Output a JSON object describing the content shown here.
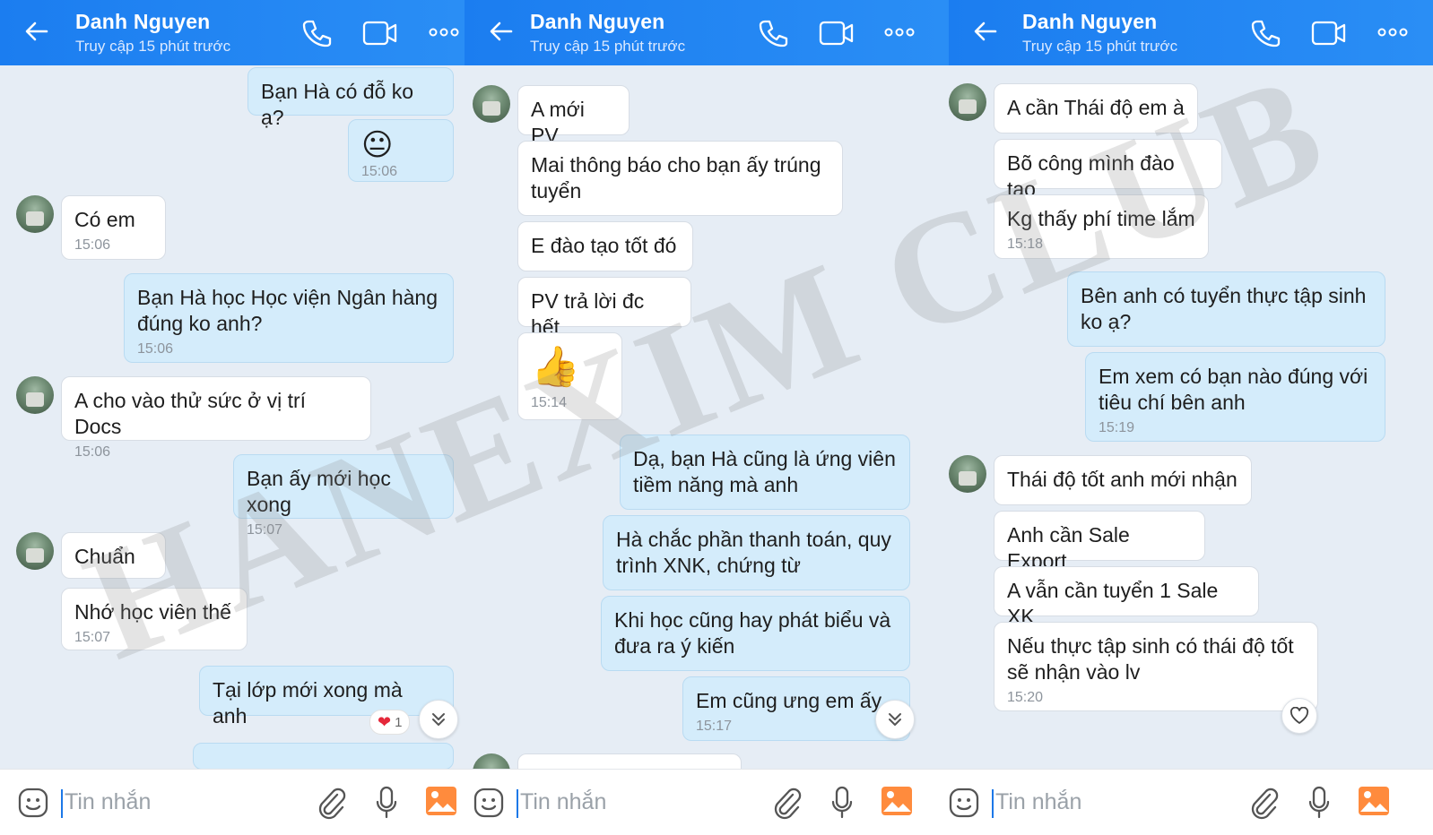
{
  "header": {
    "contact_name": "Danh Nguyen",
    "status": "Truy cập 15 phút trước"
  },
  "footer": {
    "placeholder": "Tin nhắn"
  },
  "watermark": "HANEXIM CLUB",
  "panel1": {
    "messages": [
      {
        "text": "Bạn Hà có đỗ ko ạ?"
      },
      {
        "emoji": "😐",
        "time": "15:06"
      },
      {
        "text": "Có em",
        "time": "15:06"
      },
      {
        "text": "Bạn Hà học Học viện Ngân hàng đúng ko anh?",
        "time": "15:06"
      },
      {
        "text": "A cho vào thử sức ở vị trí Docs",
        "time": "15:06"
      },
      {
        "text": "Bạn ấy mới học xong",
        "time": "15:07"
      },
      {
        "text": "Chuẩn"
      },
      {
        "text": "Nhớ học viên thế",
        "time": "15:07"
      },
      {
        "text": "Tại lớp mới xong mà anh",
        "reaction_count": "1"
      }
    ]
  },
  "panel2": {
    "messages": [
      {
        "text": "A mới PV"
      },
      {
        "text": "Mai thông báo cho bạn ấy trúng tuyển"
      },
      {
        "text": "E đào tạo tốt đó"
      },
      {
        "text": "PV trả lời đc hết"
      },
      {
        "emoji": "👍",
        "time": "15:14"
      },
      {
        "text": "Dạ, bạn Hà cũng là ứng viên tiềm năng mà anh"
      },
      {
        "text": "Hà chắc phần thanh toán, quy trình XNK, chứng từ"
      },
      {
        "text": "Khi học cũng hay phát biểu và đưa ra ý kiến"
      },
      {
        "text": "Em cũng ưng em ấy",
        "time": "15:17"
      }
    ]
  },
  "panel3": {
    "messages": [
      {
        "text": "A cần Thái độ em à"
      },
      {
        "text": "Bõ công mình đào tạo"
      },
      {
        "text": "Kg thấy phí time lắm",
        "time": "15:18"
      },
      {
        "text": "Bên anh có tuyển thực tập sinh ko ạ?"
      },
      {
        "text": "Em xem có bạn nào đúng với tiêu chí bên anh",
        "time": "15:19"
      },
      {
        "text": "Thái độ tốt anh mới nhận"
      },
      {
        "text": "Anh cần Sale Export"
      },
      {
        "text": "A vẫn cần tuyển 1 Sale XK"
      },
      {
        "text": "Nếu thực tập sinh có thái độ tốt sẽ nhận vào lv",
        "time": "15:20"
      }
    ]
  }
}
